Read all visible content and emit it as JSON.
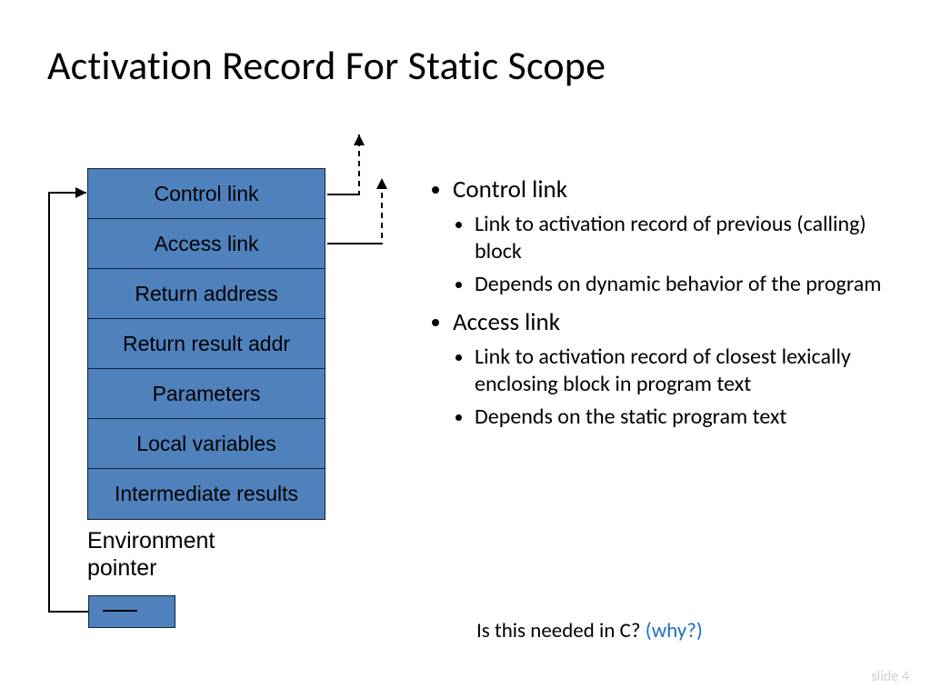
{
  "title": "Activation Record For Static Scope",
  "stack": {
    "items": [
      "Control link",
      "Access link",
      "Return address",
      "Return result addr",
      "Parameters",
      "Local variables",
      "Intermediate results"
    ]
  },
  "envlabel": {
    "line1": "Environment",
    "line2": "pointer"
  },
  "bullets": {
    "b1": "Control link",
    "b1a": "Link to activation record of previous (calling) block",
    "b1b": "Depends on dynamic behavior of the program",
    "b2": "Access link",
    "b2a": "Link to activation record of closest lexically enclosing block in program text",
    "b2b": "Depends on the static program text"
  },
  "question": {
    "text": "Is this needed in C?  ",
    "why": "(why?)"
  },
  "slideno": "slide 4"
}
